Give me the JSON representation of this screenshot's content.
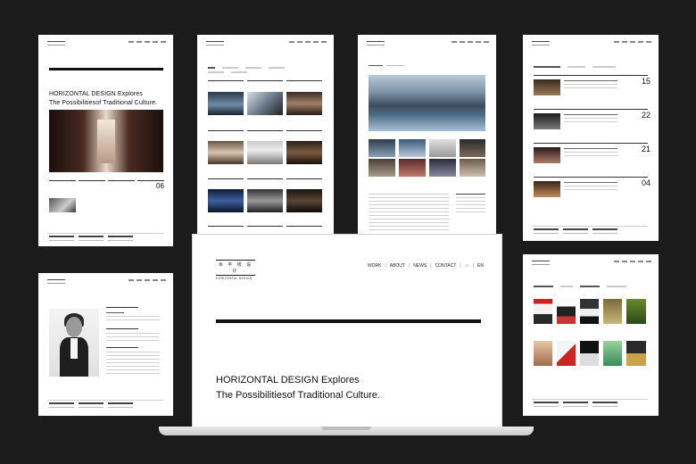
{
  "laptop": {
    "logo_glyphs": "水 平 线 设 计",
    "logo_subtitle": "HORIZONTAL DESIGN",
    "nav": [
      "WORK",
      "ABOUT",
      "NEWS",
      "CONTACT",
      "中",
      "EN"
    ],
    "nav_separator": "|",
    "headline_line1": "HORIZONTAL DESIGN Explores",
    "headline_line2": "The Possibilitiesof Traditional Culture."
  },
  "home_page": {
    "headline_line1": "HORIZONTAL DESIGN Explores",
    "headline_line2": "The Possibilitiesof Traditional Culture.",
    "date_number": "06"
  },
  "news_page": {
    "dates": [
      "15",
      "22",
      "21",
      "04"
    ]
  },
  "colors": {
    "background": "#1b1b1b",
    "page": "#ffffff",
    "ink": "#111111"
  }
}
